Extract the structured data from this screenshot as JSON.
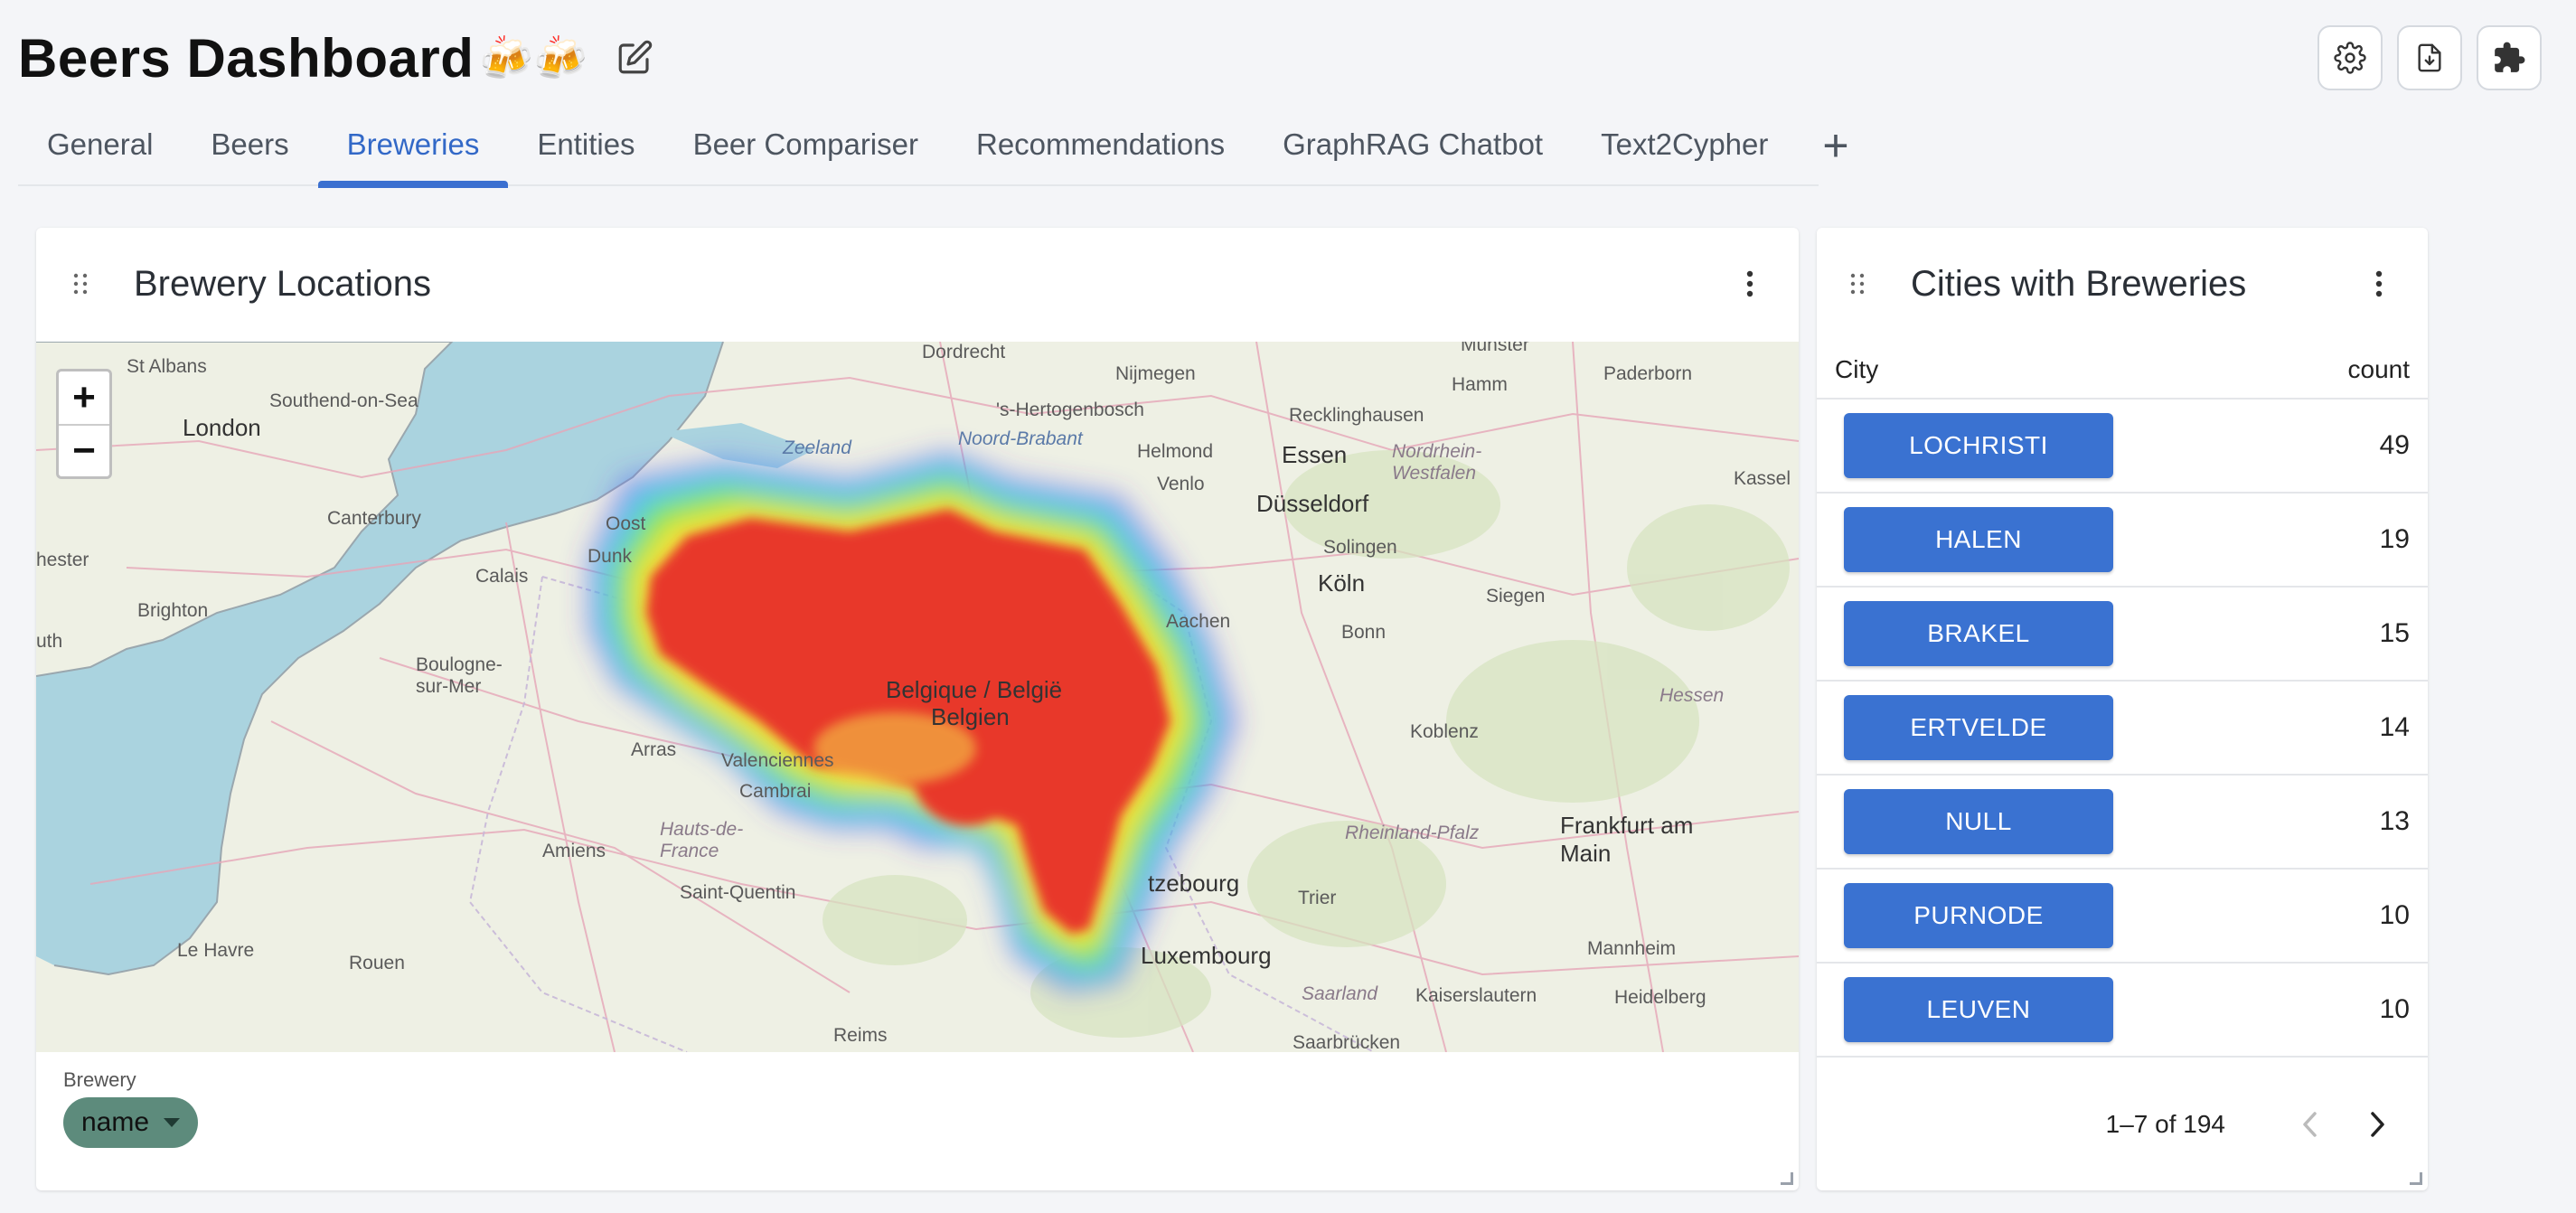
{
  "dashboard": {
    "title": "Beers Dashboard",
    "title_emoji": "🍻🍻"
  },
  "toolbar": {
    "settings_icon": "gear-icon",
    "download_icon": "file-download-icon",
    "extensions_icon": "puzzle-icon"
  },
  "tabs": [
    {
      "label": "General",
      "active": false
    },
    {
      "label": "Beers",
      "active": false
    },
    {
      "label": "Breweries",
      "active": true
    },
    {
      "label": "Entities",
      "active": false
    },
    {
      "label": "Beer Compariser",
      "active": false
    },
    {
      "label": "Recommendations",
      "active": false
    },
    {
      "label": "GraphRAG Chatbot",
      "active": false
    },
    {
      "label": "Text2Cypher",
      "active": false
    }
  ],
  "tab_add_label": "+",
  "map_card": {
    "title": "Brewery Locations",
    "zoom_in": "+",
    "zoom_out": "−",
    "field_caption": "Brewery",
    "chip_label": "name",
    "map_labels": [
      "St Albans",
      "Southend-on-Sea",
      "London",
      "Canterbury",
      "hester",
      "Brighton",
      "uth",
      "Calais",
      "Boulogne-sur-Mer",
      "Dunk",
      "Oost",
      "Dordrecht",
      "'s-Hertogenbosch",
      "Nijmegen",
      "Zeeland",
      "Noord-Brabant",
      "Helmond",
      "Venlo",
      "Essen",
      "Recklinghausen",
      "Hamm",
      "Paderborn",
      "Düsseldorf",
      "Nordrhein-Westfalen",
      "Solingen",
      "Köln",
      "Kassel",
      "Aachen",
      "Bonn",
      "Siegen",
      "Arras",
      "Valenciennes",
      "Belgique / België",
      "Belgien",
      "Cambrai",
      "Hauts-de-France",
      "Amiens",
      "Saint-Quentin",
      "Koblenz",
      "Hessen",
      "Frankfurt am Main",
      "Rheinland-Pfalz",
      "Trier",
      "tzebourg",
      "Luxembourg",
      "Le Havre",
      "Rouen",
      "Reims",
      "Saarland",
      "Kaiserslautern",
      "Mannheim",
      "Heidelberg",
      "Saarbrücken",
      "Munster"
    ],
    "colors": {
      "sea": "#aad3df",
      "land": "#eef0e4",
      "heat_core": "#e8382b",
      "heat_edge": "#3b3bf5"
    }
  },
  "table_card": {
    "title": "Cities with Breweries",
    "columns": {
      "city": "City",
      "count": "count"
    },
    "rows": [
      {
        "city": "LOCHRISTI",
        "count": "49"
      },
      {
        "city": "HALEN",
        "count": "19"
      },
      {
        "city": "BRAKEL",
        "count": "15"
      },
      {
        "city": "ERTVELDE",
        "count": "14"
      },
      {
        "city": "NULL",
        "count": "13"
      },
      {
        "city": "PURNODE",
        "count": "10"
      },
      {
        "city": "LEUVEN",
        "count": "10"
      }
    ],
    "pagination": "1–7 of 194",
    "accent": "#3a72d1"
  }
}
